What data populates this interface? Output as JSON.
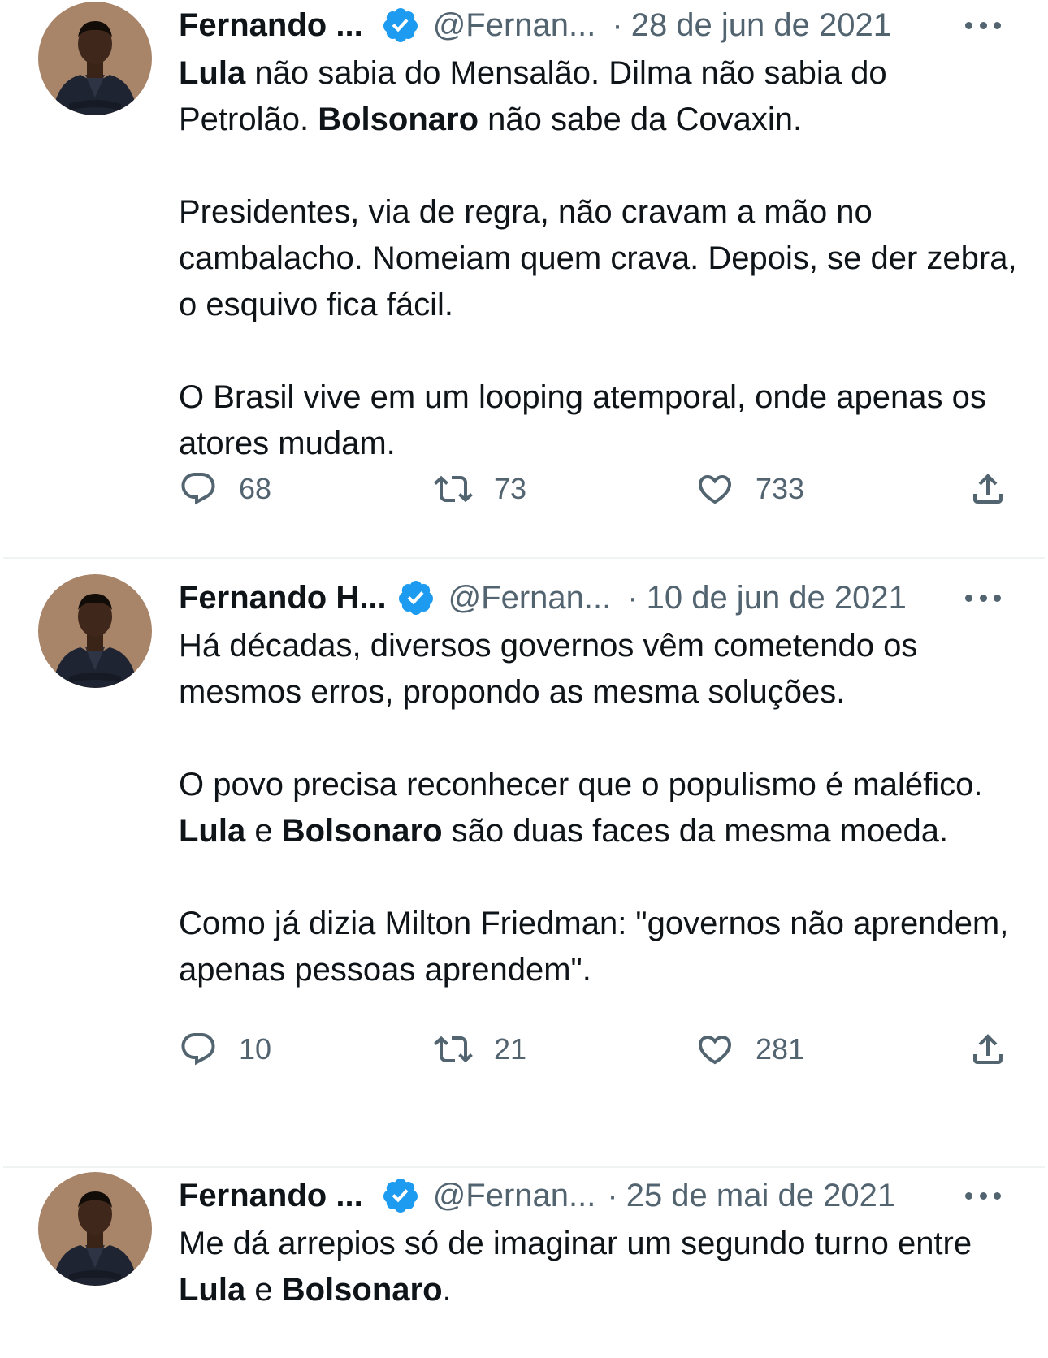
{
  "tweets": [
    {
      "name": "Fernando ...",
      "handle": "@Fernan...",
      "date": "28 de jun de 2021",
      "paragraphs": [
        [
          {
            "t": "Lula",
            "b": true
          },
          {
            "t": " não sabia do Mensalão. Dilma não sabia do Petrolão. "
          },
          {
            "t": "Bolsonaro",
            "b": true
          },
          {
            "t": " não sabe da Covaxin."
          }
        ],
        [
          {
            "t": "Presidentes, via de regra, não cravam a mão no cambalacho. Nomeiam quem crava. Depois, se der zebra, o esquivo fica fácil."
          }
        ],
        [
          {
            "t": "O Brasil vive em um looping atemporal, onde apenas os atores mudam."
          }
        ]
      ],
      "replies": "68",
      "retweets": "73",
      "likes": "733"
    },
    {
      "name": "Fernando H...",
      "handle": "@Fernan...",
      "date": "10 de jun de 2021",
      "paragraphs": [
        [
          {
            "t": "Há décadas, diversos governos vêm cometendo os mesmos erros, propondo as mesma soluções."
          }
        ],
        [
          {
            "t": "O povo precisa reconhecer que o populismo é maléfico. "
          },
          {
            "t": "Lula",
            "b": true
          },
          {
            "t": " e "
          },
          {
            "t": "Bolsonaro",
            "b": true
          },
          {
            "t": " são duas faces da mesma moeda."
          }
        ],
        [
          {
            "t": "Como já dizia Milton Friedman: \"governos não aprendem, apenas pessoas aprendem\"."
          }
        ]
      ],
      "replies": "10",
      "retweets": "21",
      "likes": "281"
    },
    {
      "name": "Fernando ...",
      "handle": "@Fernan...",
      "date": "25 de mai de 2021",
      "paragraphs": [
        [
          {
            "t": "Me dá arrepios só de imaginar um segundo turno entre "
          },
          {
            "t": "Lula",
            "b": true
          },
          {
            "t": " e "
          },
          {
            "t": "Bolsonaro",
            "b": true
          },
          {
            "t": "."
          }
        ]
      ]
    }
  ],
  "icons": {
    "verified": "verified-badge-icon",
    "more": "more-options-icon",
    "reply": "reply-icon",
    "retweet": "retweet-icon",
    "like": "like-icon",
    "share": "share-icon"
  },
  "colors": {
    "text": "#0f1419",
    "secondary": "#536471",
    "verified": "#1d9bf0",
    "divider": "#eff3f4"
  }
}
